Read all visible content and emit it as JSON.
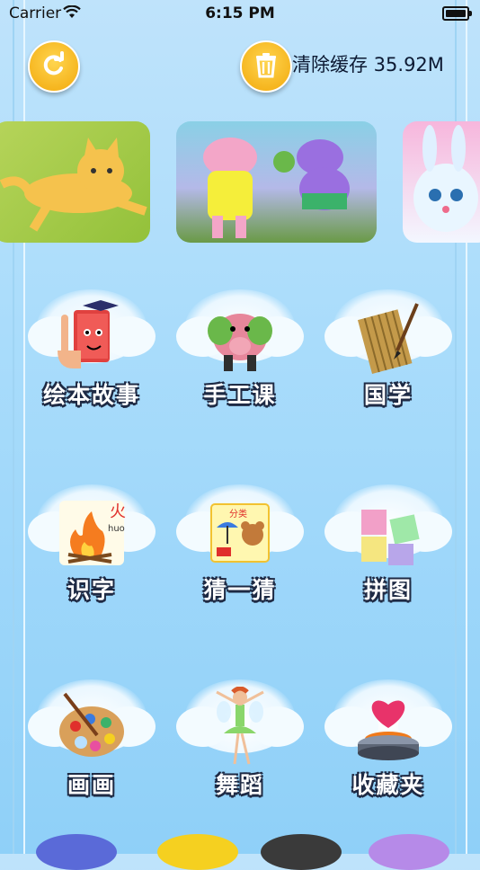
{
  "status_bar": {
    "carrier": "Carrier",
    "time": "6:15 PM"
  },
  "toolbar": {
    "cache_label": "清除缓存 35.92M"
  },
  "grid": [
    {
      "label": "绘本故事",
      "icon": "storybook-icon"
    },
    {
      "label": "手工课",
      "icon": "clay-elephant-icon"
    },
    {
      "label": "国学",
      "icon": "bamboo-scroll-icon"
    },
    {
      "label": "识字",
      "icon": "fire-character-icon"
    },
    {
      "label": "猜一猜",
      "icon": "guess-cards-icon"
    },
    {
      "label": "拼图",
      "icon": "puzzle-icon"
    },
    {
      "label": "画画",
      "icon": "paint-palette-icon"
    },
    {
      "label": "舞蹈",
      "icon": "ballerina-icon"
    },
    {
      "label": "收藏夹",
      "icon": "heart-box-icon"
    }
  ],
  "icon_text": {
    "fire_char": "火",
    "fire_pinyin": "huo",
    "card_title": "分类"
  },
  "colors": {
    "accent": "#f2a90c",
    "background": "#a9dcfb",
    "label_outline": "#1e2a44"
  }
}
